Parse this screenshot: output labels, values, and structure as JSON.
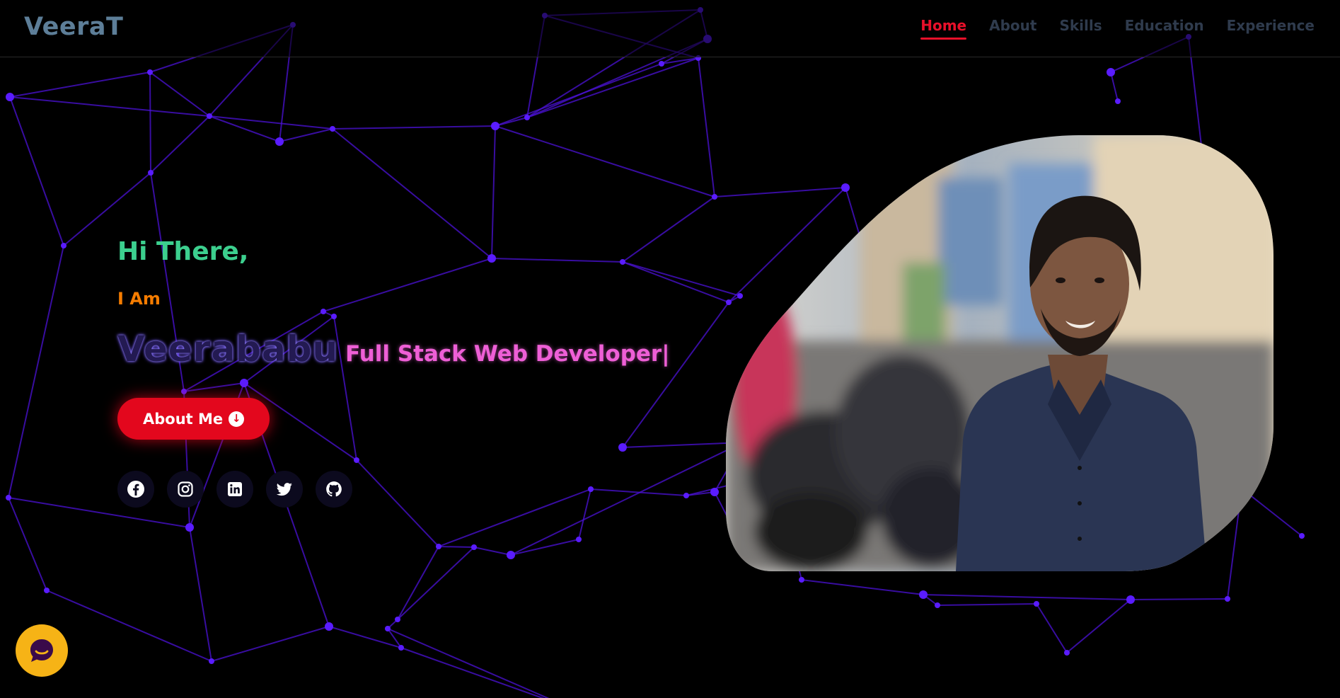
{
  "brand": {
    "logo_text": "VeeraT"
  },
  "nav": {
    "items": [
      {
        "label": "Home",
        "active": true
      },
      {
        "label": "About",
        "active": false
      },
      {
        "label": "Skills",
        "active": false
      },
      {
        "label": "Education",
        "active": false
      },
      {
        "label": "Experience",
        "active": false
      }
    ]
  },
  "hero": {
    "greeting": "Hi There,",
    "intro": "I Am",
    "name": "Veerababu",
    "role": "Full Stack Web Developer",
    "cursor": "|",
    "button_label": "About Me",
    "button_icon": "arrow-down-circle-icon"
  },
  "socials": [
    {
      "icon": "facebook-icon"
    },
    {
      "icon": "instagram-icon"
    },
    {
      "icon": "linkedin-icon"
    },
    {
      "icon": "twitter-icon"
    },
    {
      "icon": "github-icon"
    }
  ],
  "profile_image": {
    "subject": "profile-photo"
  },
  "chat_widget": {
    "icon": "chat-icon"
  },
  "colors": {
    "background": "#000000",
    "brand": "#5d7e98",
    "nav_active": "#e8102a",
    "nav_inactive": "#2f3b4d",
    "greeting": "#3ccf8e",
    "intro": "#f57c00",
    "role": "#ee5fd6",
    "button": "#e3071d",
    "particles": "#4b12d6",
    "chat_widget": "#f6b316"
  }
}
